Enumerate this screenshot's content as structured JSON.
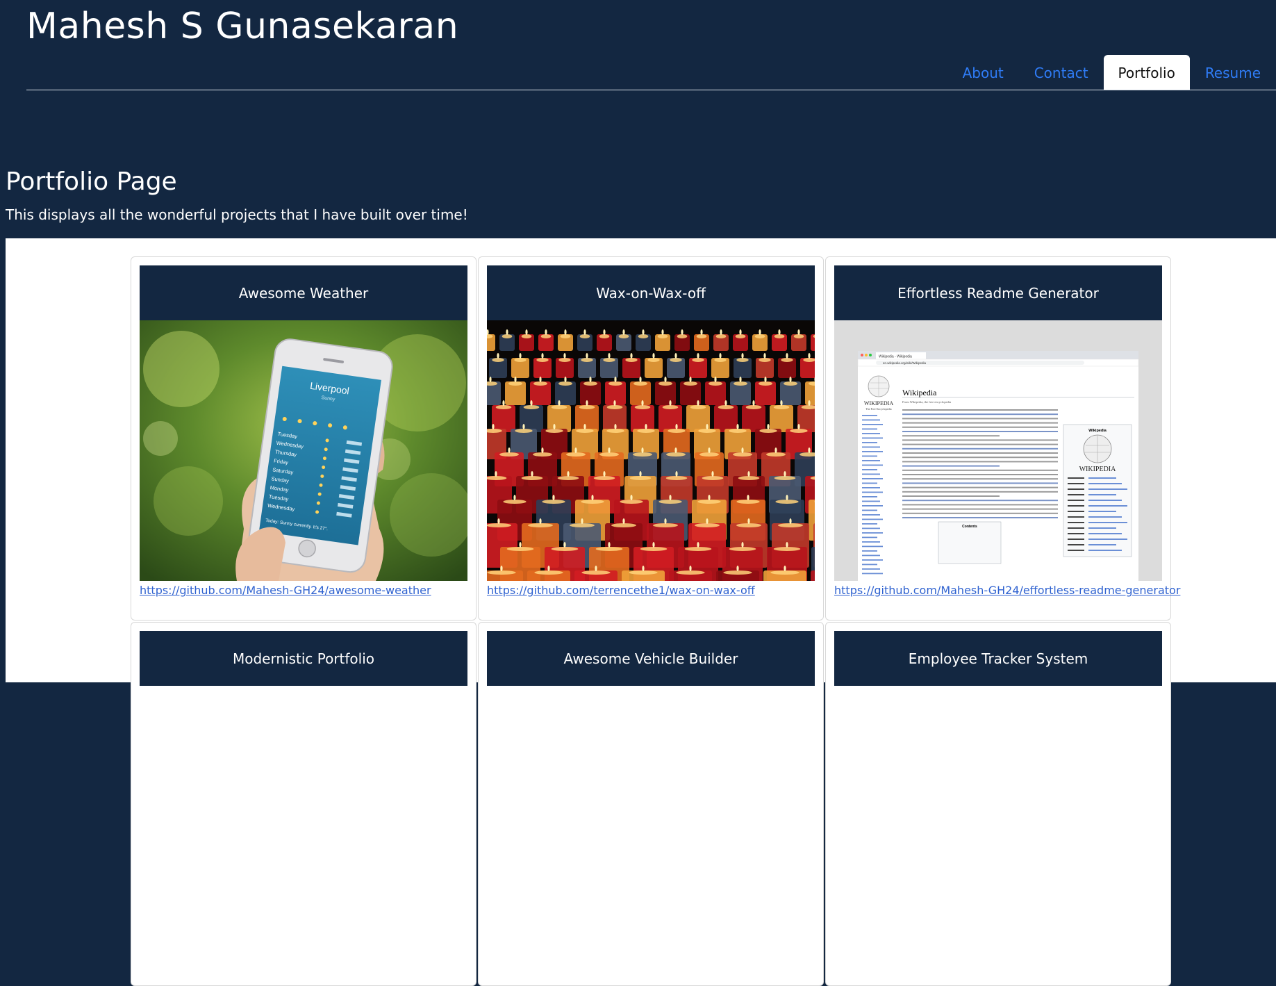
{
  "header": {
    "site_title": "Mahesh S Gunasekaran",
    "nav": [
      {
        "label": "About",
        "active": false
      },
      {
        "label": "Contact",
        "active": false
      },
      {
        "label": "Portfolio",
        "active": true
      },
      {
        "label": "Resume",
        "active": false
      }
    ]
  },
  "main": {
    "title": "Portfolio Page",
    "subtitle": "This displays all the wonderful projects that I have built over time!"
  },
  "projects": [
    {
      "title": "Awesome Weather",
      "link": "https://github.com/Mahesh-GH24/awesome-weather"
    },
    {
      "title": "Wax-on-Wax-off",
      "link": "https://github.com/terrencethe1/wax-on-wax-off"
    },
    {
      "title": "Effortless Readme Generator",
      "link": "https://github.com/Mahesh-GH24/effortless-readme-generator"
    },
    {
      "title": "Modernistic Portfolio"
    },
    {
      "title": "Awesome Vehicle Builder"
    },
    {
      "title": "Employee Tracker System"
    }
  ],
  "phone_screen": {
    "city": "Liverpool",
    "condition": "Sunny",
    "days": [
      "Tuesday",
      "Wednesday",
      "Thursday",
      "Friday",
      "Saturday",
      "Sunday",
      "Monday",
      "Tuesday",
      "Wednesday"
    ],
    "footer": "Today: Sunny currently. It's 27°."
  },
  "wiki_screen": {
    "tab": "Wikipedia - Wikipedia",
    "url": "en.wikipedia.org/wiki/Wikipedia",
    "logo": "WIKIPEDIA",
    "tagline": "The Free Encyclopedia",
    "heading": "Wikipedia",
    "from": "From Wikipedia, the free encyclopedia",
    "infobox_title": "Wikipedia",
    "infobox_logo": "WIKIPEDIA",
    "contents": "Contents"
  },
  "colors": {
    "navy": "#132741",
    "link": "#2f7cf6",
    "card_link": "#2f62d0"
  }
}
